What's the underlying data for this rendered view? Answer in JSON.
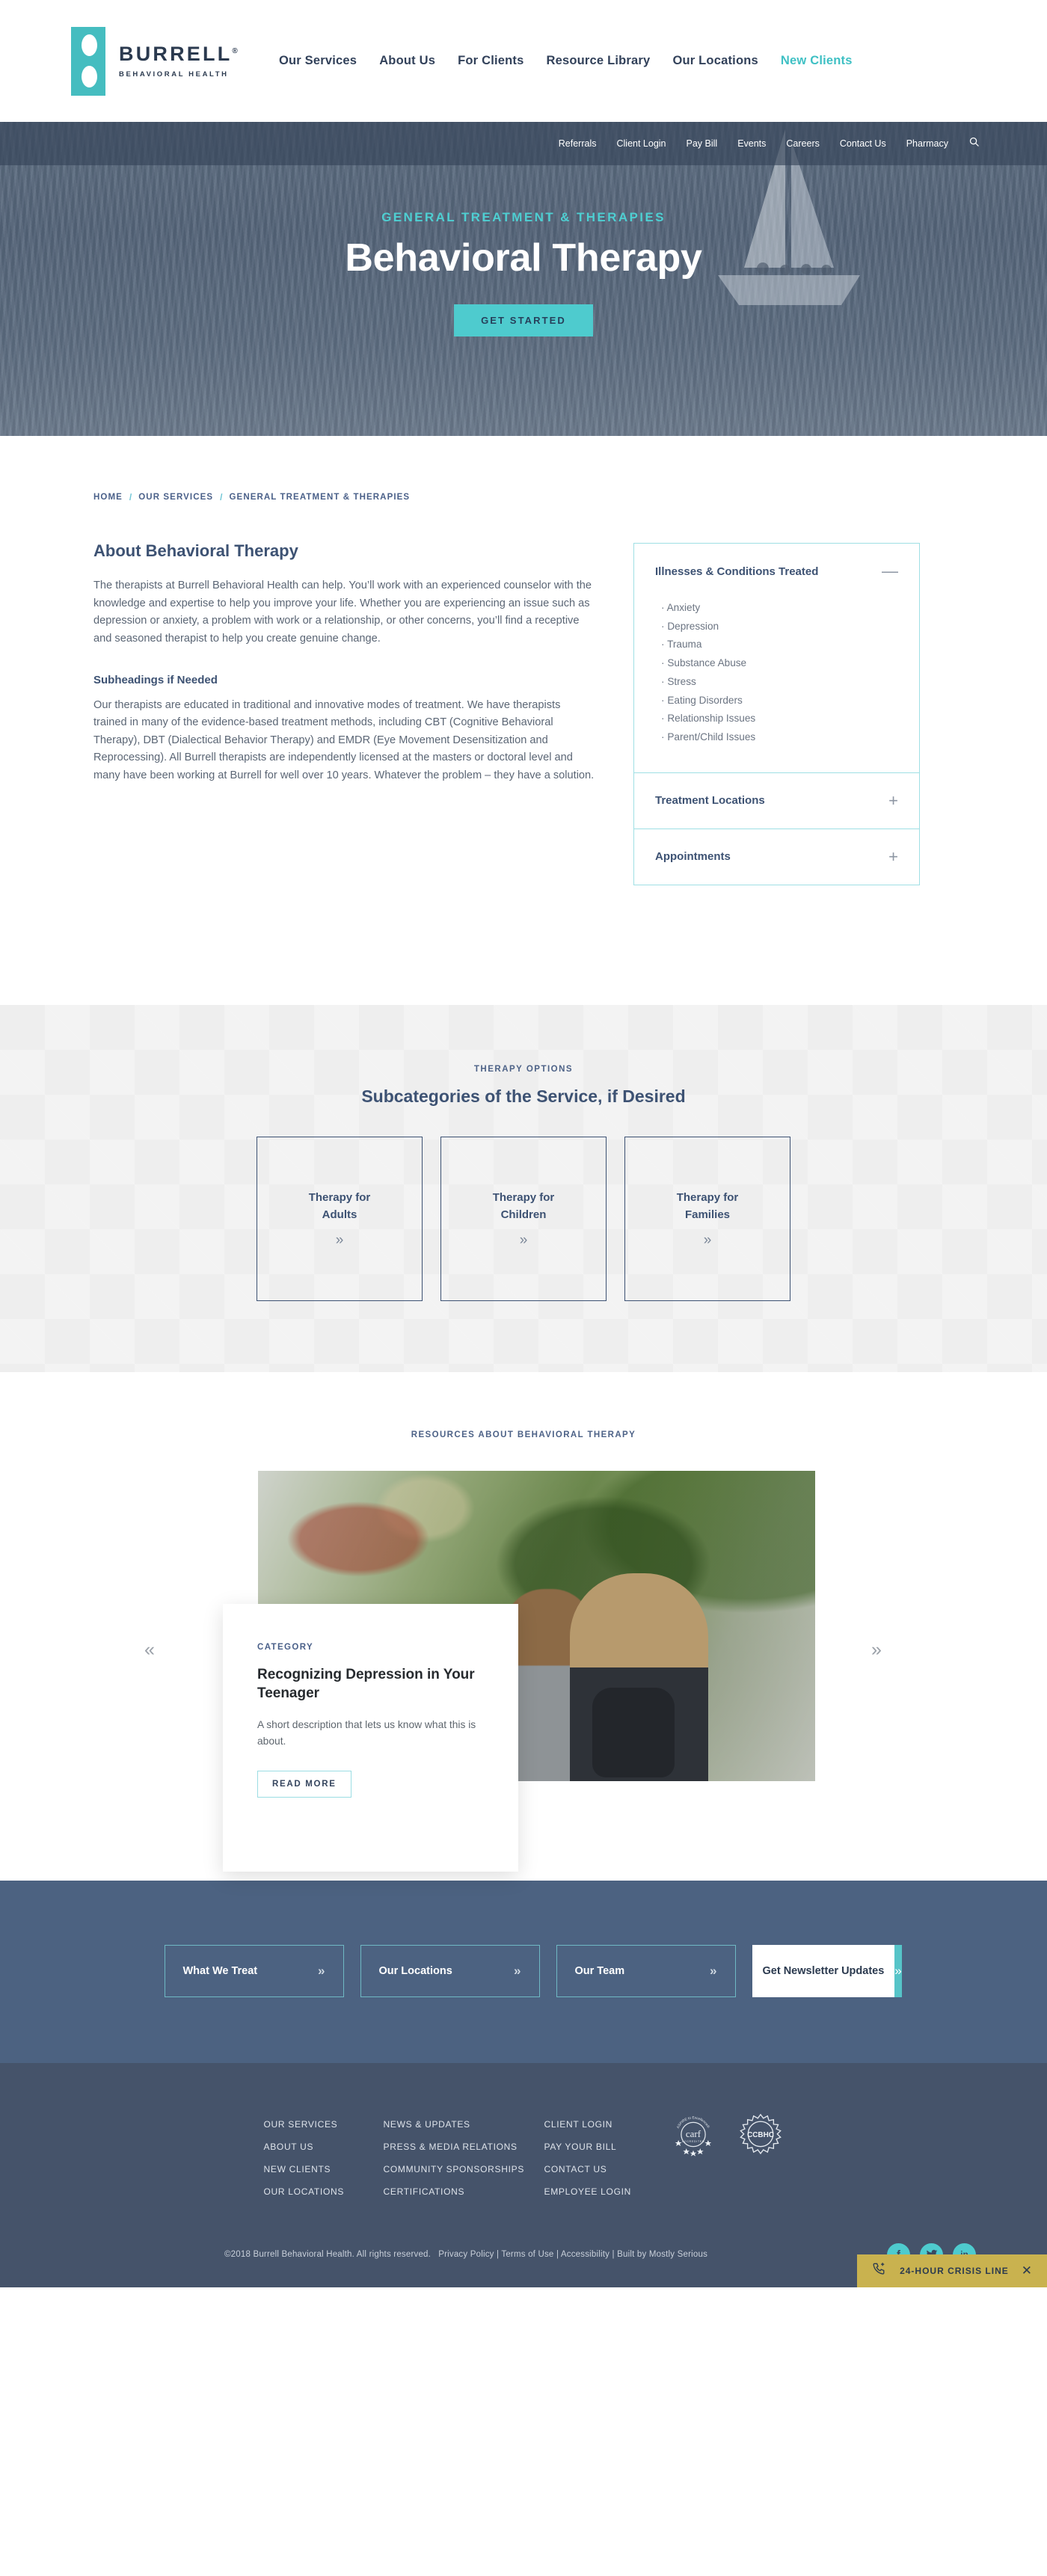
{
  "brand": {
    "name": "BURRELL",
    "registered": "®",
    "tagline": "BEHAVIORAL HEALTH",
    "logo_color": "#45bdc0",
    "accent_color": "#3fc0c4",
    "navy": "#32415a"
  },
  "mainnav": [
    {
      "label": "Our Services",
      "accent": false
    },
    {
      "label": "About Us",
      "accent": false
    },
    {
      "label": "For Clients",
      "accent": false
    },
    {
      "label": "Resource Library",
      "accent": false
    },
    {
      "label": "Our Locations",
      "accent": false
    },
    {
      "label": "New Clients",
      "accent": true
    }
  ],
  "utilitynav": [
    {
      "label": "Referrals"
    },
    {
      "label": "Client Login"
    },
    {
      "label": "Pay Bill"
    },
    {
      "label": "Events"
    },
    {
      "label": "Careers"
    },
    {
      "label": "Contact Us"
    },
    {
      "label": "Pharmacy"
    }
  ],
  "utilitynav_icon": "search-icon",
  "hero": {
    "eyebrow": "GENERAL TREATMENT & THERAPIES",
    "title": "Behavioral Therapy",
    "button": "GET STARTED",
    "button_color": "#4ecbce"
  },
  "breadcrumb": {
    "items": [
      "HOME",
      "OUR SERVICES",
      "GENERAL TREATMENT & THERAPIES"
    ],
    "separator": "/"
  },
  "about": {
    "heading": "About Behavioral Therapy",
    "paragraph": "The therapists at Burrell Behavioral Health can help. You’ll work with an experienced counselor with the knowledge and expertise to help you improve your life. Whether you are experiencing an issue such as depression or anxiety, a problem with work or a relationship, or other concerns, you’ll find a receptive and seasoned therapist to help you create genuine change.",
    "subheading": "Subheadings if Needed",
    "subparagraph": "Our therapists are educated in traditional and innovative modes of treatment. We have therapists trained in many of the evidence-based treatment methods, including CBT (Cognitive Behavioral Therapy), DBT (Dialectical Behavior Therapy) and EMDR (Eye Movement Desensitization and Reprocessing). All Burrell therapists are independently licensed at the masters or doctoral level and many have been working at Burrell for well over 10 years. Whatever the problem – they have a solution."
  },
  "accordion": [
    {
      "title": "Illnesses & Conditions Treated",
      "sign": "—",
      "expanded": true,
      "items": [
        "Anxiety",
        "Depression",
        "Trauma",
        "Substance Abuse",
        "Stress",
        "Eating Disorders",
        "Relationship Issues",
        "Parent/Child Issues"
      ]
    },
    {
      "title": "Treatment Locations",
      "sign": "+",
      "expanded": false,
      "items": []
    },
    {
      "title": "Appointments",
      "sign": "+",
      "expanded": false,
      "items": []
    }
  ],
  "subcategories": {
    "eyebrow": "THERAPY OPTIONS",
    "title": "Subcategories of the Service, if Desired",
    "cards": [
      {
        "line1": "Therapy for",
        "line2": "Adults",
        "arrow": "»"
      },
      {
        "line1": "Therapy for",
        "line2": "Children",
        "arrow": "»"
      },
      {
        "line1": "Therapy for",
        "line2": "Families",
        "arrow": "»"
      }
    ]
  },
  "resources": {
    "eyebrow": "RESOURCES ABOUT BEHAVIORAL THERAPY",
    "prev_arrow": "«",
    "next_arrow": "»",
    "card": {
      "category": "CATEGORY",
      "title": "Recognizing Depression in Your Teenager",
      "description": "A short description that lets us know what this is about.",
      "button": "READ MORE"
    }
  },
  "cta": {
    "buttons": [
      {
        "label": "What We Treat",
        "chev": "»"
      },
      {
        "label": "Our Locations",
        "chev": "»"
      },
      {
        "label": "Our Team",
        "chev": "»"
      }
    ],
    "newsletter": {
      "label": "Get Newsletter Updates",
      "chev": "»"
    }
  },
  "footer": {
    "col1": [
      "OUR SERVICES",
      "ABOUT US",
      "NEW CLIENTS",
      "OUR LOCATIONS"
    ],
    "col2": [
      "NEWS & UPDATES",
      "PRESS & MEDIA RELATIONS",
      "COMMUNITY SPONSORSHIPS",
      "CERTIFICATIONS"
    ],
    "col3": [
      "CLIENT LOGIN",
      "PAY YOUR BILL",
      "CONTACT US",
      "EMPLOYEE LOGIN"
    ],
    "badges": [
      {
        "name": "carf-accredited-badge",
        "top_text": "ASPIRE to Excellence®",
        "main_text": "carf",
        "sub_text": "ACCREDITED"
      },
      {
        "name": "ccbhc-badge",
        "main_text": "CCBHC"
      }
    ],
    "copyright": "©2018 Burrell Behavioral Health. All rights reserved.",
    "legal_links": [
      "Privacy Policy",
      "Terms of Use",
      "Accessibility",
      "Built by Mostly Serious"
    ],
    "legal_separator": "|",
    "socials": [
      {
        "name": "facebook-icon",
        "glyph": "f"
      },
      {
        "name": "twitter-icon",
        "glyph": "🐦"
      },
      {
        "name": "linkedin-icon",
        "glyph": "in"
      }
    ]
  },
  "crisis": {
    "icon": "phone-plus-icon",
    "label": "24-HOUR CRISIS LINE",
    "close": "✕",
    "color": "#c9b24f"
  }
}
